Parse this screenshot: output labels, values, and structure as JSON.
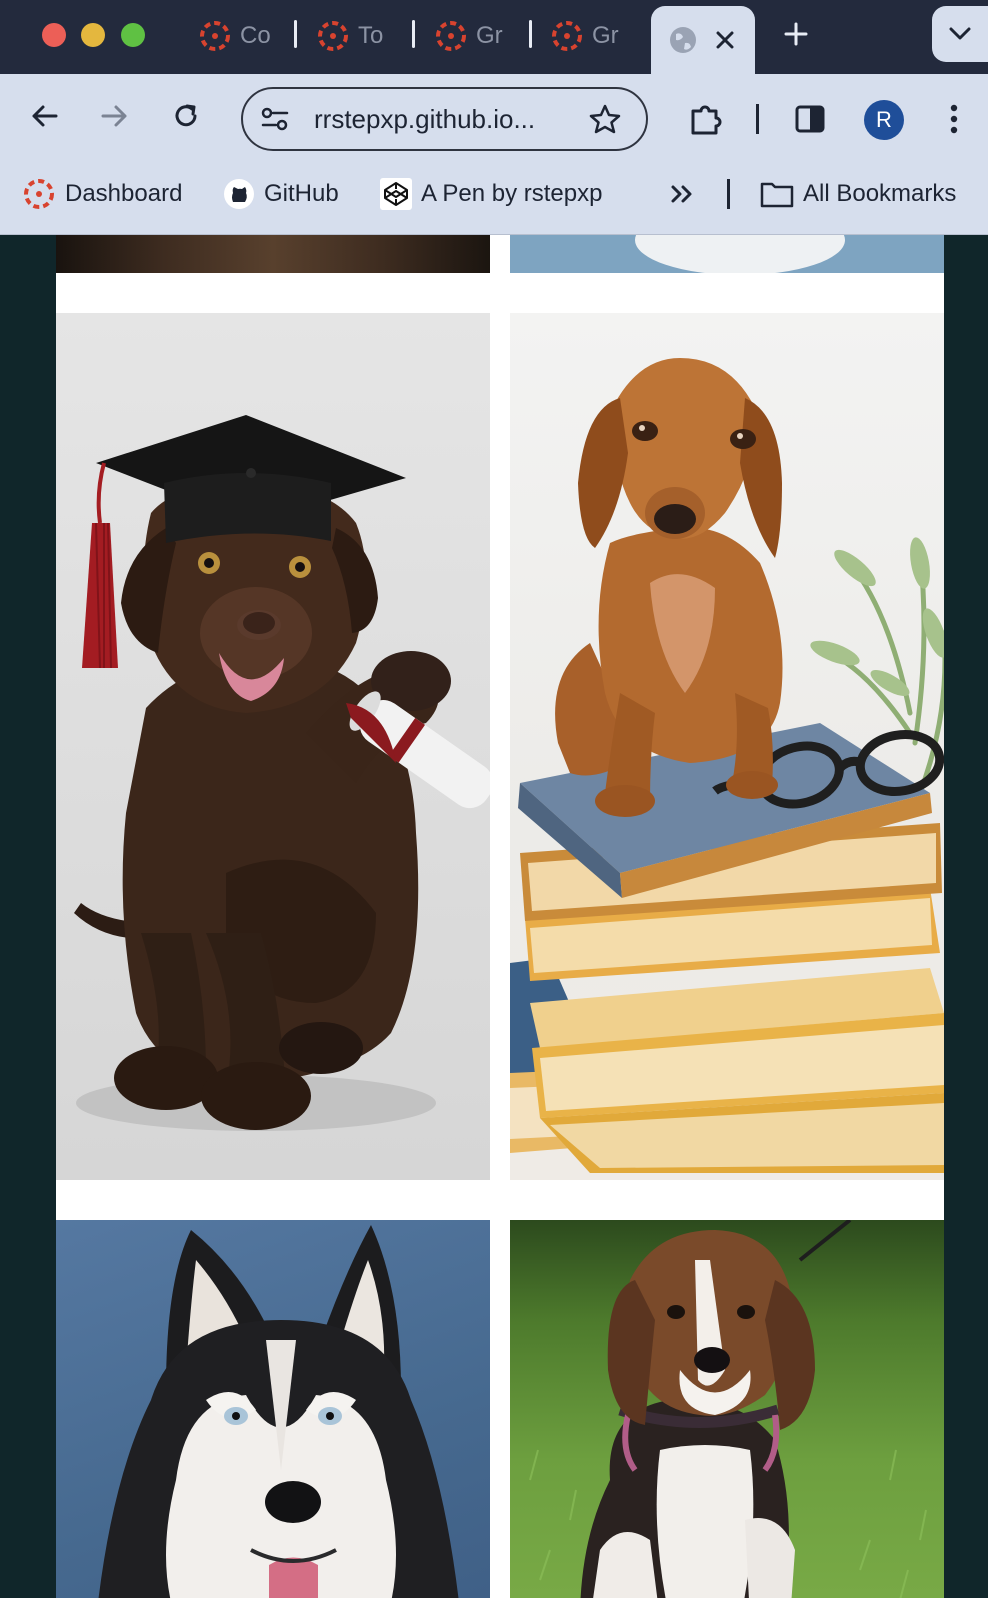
{
  "browser": {
    "tabs": [
      {
        "label": "Co",
        "icon": "canvas-icon"
      },
      {
        "label": "To",
        "icon": "canvas-icon"
      },
      {
        "label": "Gr",
        "icon": "canvas-icon"
      },
      {
        "label": "Gr",
        "icon": "canvas-icon"
      }
    ],
    "active_tab": {
      "icon": "globe-icon"
    },
    "url": "rrstepxp.github.io...",
    "profile_initial": "R",
    "bookmarks": [
      {
        "label": "Dashboard",
        "icon": "canvas-icon"
      },
      {
        "label": "GitHub",
        "icon": "github-icon"
      },
      {
        "label": "A Pen by rstepxp",
        "icon": "codepen-icon"
      }
    ],
    "all_bookmarks_label": "All Bookmarks"
  },
  "gallery": {
    "photos": [
      {
        "subject": "dark-dog-partial"
      },
      {
        "subject": "white-dog-partial"
      },
      {
        "subject": "chocolate-lab-graduate"
      },
      {
        "subject": "dachshund-on-books"
      },
      {
        "subject": "siberian-husky"
      },
      {
        "subject": "beagle-on-grass"
      }
    ]
  },
  "colors": {
    "chrome_dark": "#232a3d",
    "chrome_light": "#d6deed",
    "page_bg": "#10262a",
    "profile_blue": "#1f4e99"
  }
}
